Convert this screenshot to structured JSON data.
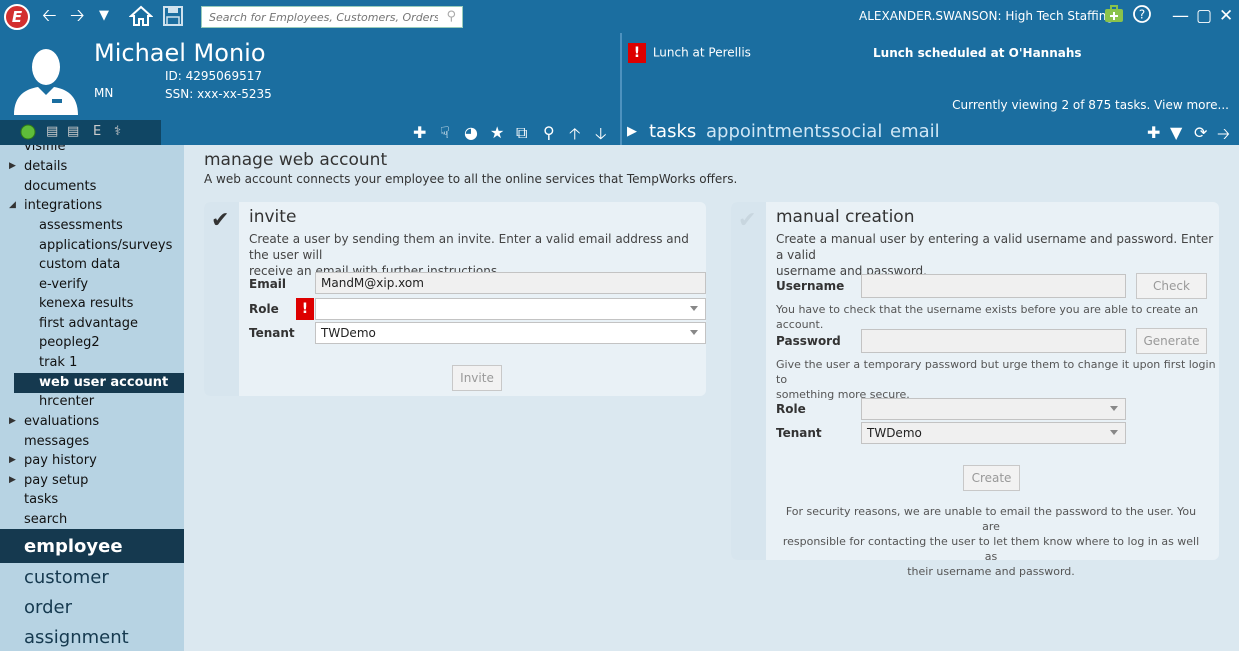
{
  "topbar": {
    "logo_letter": "E",
    "search_placeholder": "Search for Employees, Customers, Orders, etc.",
    "user": "ALEXANDER.SWANSON: High Tech Staffing"
  },
  "employee": {
    "name": "Michael Monio",
    "initials": "MN",
    "id": "ID: 4295069517",
    "ssn": "SSN: xxx-xx-5235",
    "status_letter": "E"
  },
  "tasks_panel": {
    "task1": "Lunch at Perellis",
    "task2": "Lunch scheduled at O'Hannahs",
    "viewing": "Currently viewing 2 of 875 tasks. View more...",
    "tabs": [
      "tasks",
      "appointments",
      "social",
      "email"
    ]
  },
  "sidebar": {
    "items": [
      {
        "label": "visifile",
        "arrow": false
      },
      {
        "label": "details",
        "arrow": true
      },
      {
        "label": "documents",
        "arrow": false
      },
      {
        "label": "integrations",
        "arrow": "open"
      },
      {
        "label": "assessments",
        "indent": true
      },
      {
        "label": "applications/surveys",
        "indent": true
      },
      {
        "label": "custom data",
        "indent": true
      },
      {
        "label": "e-verify",
        "indent": true
      },
      {
        "label": "kenexa results",
        "indent": true
      },
      {
        "label": "first advantage",
        "indent": true
      },
      {
        "label": "peopleg2",
        "indent": true
      },
      {
        "label": "trak 1",
        "indent": true
      },
      {
        "label": "web user account",
        "indent": true,
        "selected": true
      },
      {
        "label": "hrcenter",
        "indent": true
      },
      {
        "label": "evaluations",
        "arrow": true
      },
      {
        "label": "messages",
        "arrow": false
      },
      {
        "label": "pay history",
        "arrow": true
      },
      {
        "label": "pay setup",
        "arrow": true
      },
      {
        "label": "tasks",
        "arrow": false
      },
      {
        "label": "search",
        "arrow": false
      }
    ],
    "nav": [
      "employee",
      "customer",
      "order",
      "assignment"
    ]
  },
  "main": {
    "title": "manage web account",
    "subtitle": "A web account connects your employee to all the online services that TempWorks offers."
  },
  "invite": {
    "title": "invite",
    "desc_line1": "Create a user by sending them an invite. Enter a valid email address and the user will",
    "desc_line2": "receive an email with further instructions.",
    "email_label": "Email",
    "email_value": "MandM@xip.xom",
    "role_label": "Role",
    "role_value": "",
    "tenant_label": "Tenant",
    "tenant_value": "TWDemo",
    "button": "Invite"
  },
  "manual": {
    "title": "manual creation",
    "desc_line1": "Create a manual user by entering a valid username and password. Enter a valid",
    "desc_line2": "username and password.",
    "username_label": "Username",
    "check_button": "Check",
    "username_hint": "You have to check that the username exists before you are able to create an account.",
    "password_label": "Password",
    "generate_button": "Generate",
    "password_hint1": "Give the user a temporary password but urge them to change it upon first login to",
    "password_hint2": "something more secure.",
    "role_label": "Role",
    "tenant_label": "Tenant",
    "tenant_value": "TWDemo",
    "create_button": "Create",
    "security1": "For security reasons, we are unable to email the password to the user.  You are",
    "security2": "responsible for contacting the user to let them know where to log in as well as",
    "security3": "their username and password."
  }
}
